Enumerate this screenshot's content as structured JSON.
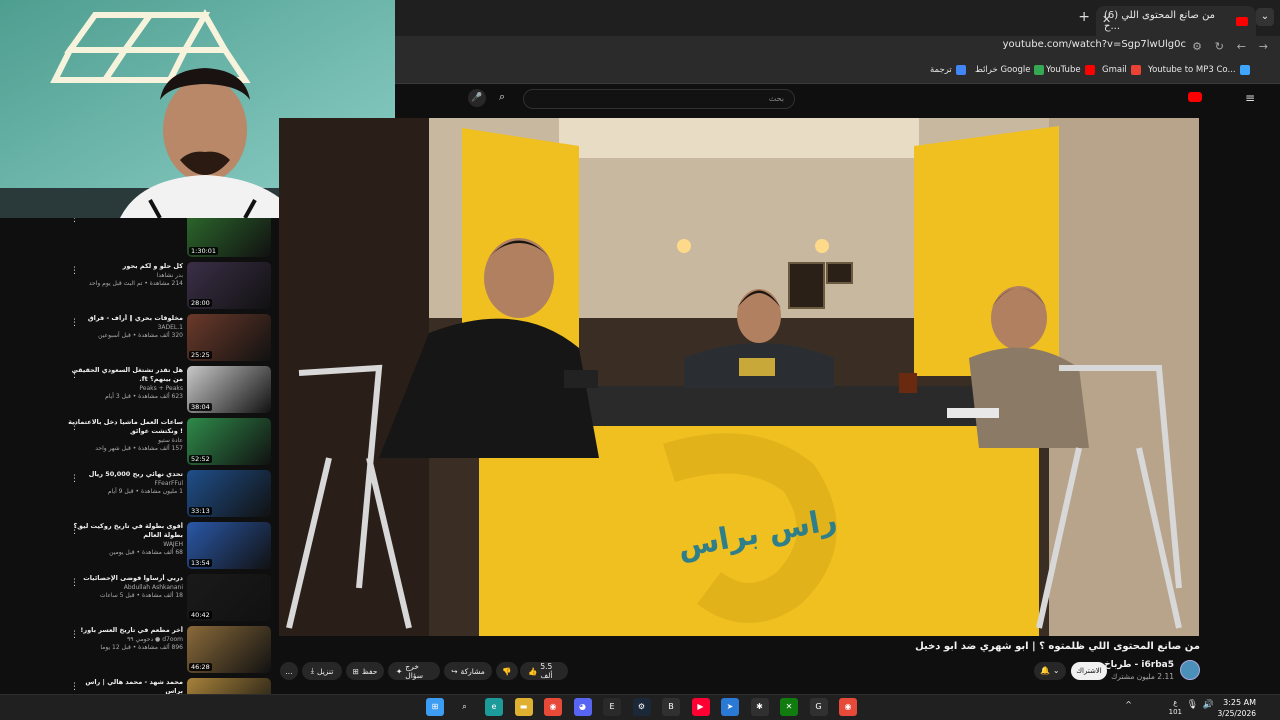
{
  "browser": {
    "tab_title": "(6) من صانع المحتوى اللي ح...",
    "url": "youtube.com/watch?v=Sgp7lwUlg0c",
    "bookmarks": [
      {
        "label": "Youtube to MP3 Co...",
        "color": "#3ea6ff"
      },
      {
        "label": "Gmail",
        "color": "#ea4335"
      },
      {
        "label": "YouTube",
        "color": "#ff0000"
      },
      {
        "label": "خرائط Google",
        "color": "#34a853"
      },
      {
        "label": "ترجمة",
        "color": "#4285f4"
      }
    ]
  },
  "youtube": {
    "search_placeholder": "بحث",
    "video_title": "من صانع المحتوى اللي ظلمتوه ؟ | ابو شهري ضد ابو دخيل",
    "channel_name": "i6rba5 - طرباخ",
    "subscribers": "2.11 مليون مشترك",
    "subscribe_label": "الاشتراك",
    "actions": {
      "likes": "5.5 ألف",
      "share": "مشاركة",
      "remix": "خرج سؤال",
      "save": "حفظ",
      "download": "تنزيل",
      "more": "..."
    }
  },
  "recommendations": [
    {
      "title": "",
      "channel": "",
      "meta": "239 ألف مشاهدة • قبل 10 أيام",
      "duration": "1:30:01",
      "color": "#2d6a2d"
    },
    {
      "title": "كل حلو و لكم بحور",
      "channel": "بدر نشاهدا",
      "meta": "214 مشاهدة • تم البث قبل يوم واحد",
      "duration": "28:00",
      "color": "#3b2f48"
    },
    {
      "title": "مخلوقات بحري ‖ أراف - فراق",
      "channel": "3ADEL.1",
      "meta": "320 ألف مشاهدة • قبل أسبوعين",
      "duration": "25:25",
      "color": "#6b3a2a"
    },
    {
      "title": "هل تقدر تشتغل السعودي الحقيقي من بينهم؟ ft.",
      "channel": "Peaks + Peaks",
      "meta": "623 ألف مشاهدة • قبل 3 أيام",
      "duration": "38:04",
      "color": "#c9c9c9"
    },
    {
      "title": "ساعات العمل ماشيا دخل بالاعتمادية ! ونكتشت عوائق",
      "channel": "عادة ستيو",
      "meta": "157 ألف مشاهدة • قبل شهر واحد",
      "duration": "52:52",
      "color": "#2f8a4a"
    },
    {
      "title": "تحدي نهائي ربح 50,000 ريال",
      "channel": "FFearFFul",
      "meta": "1 مليون مشاهدة • قبل 9 أيام",
      "duration": "33:13",
      "color": "#1f4f8a"
    },
    {
      "title": "أقوى بطولة في تاريخ روكيت ليق؟ بطولة العالم",
      "channel": "WAJEH",
      "meta": "68 ألف مشاهدة • قبل يومين",
      "duration": "13:54",
      "color": "#2a58a8"
    },
    {
      "title": "دربي أرساوا فوضى الإحصائيات",
      "channel": "Abdullah Ashkanani",
      "meta": "18 ألف مشاهدة • قبل 5 ساعات",
      "duration": "40:42",
      "color": "#1a1a1a"
    },
    {
      "title": "أخر مطعم في تاريخ العسر باور!",
      "channel": "d7oom ● دحومي ٩٩",
      "meta": "896 ألف مشاهدة • قبل 12 يوما",
      "duration": "46:28",
      "color": "#8a6a3a"
    },
    {
      "title": "محمد شهد - محمد هالي | راس براس",
      "channel": "i6rba5",
      "meta": "",
      "duration": "",
      "color": "#a8823a"
    }
  ],
  "taskbar": {
    "time": "3:25 AM",
    "date": "3/25/2026",
    "lang_line1": "ع",
    "lang_line2": "101",
    "apps": [
      {
        "icon": "windows-start",
        "color": "#3d9df2"
      },
      {
        "icon": "search",
        "color": "#202020"
      },
      {
        "icon": "edge",
        "color": "#1d9a9a"
      },
      {
        "icon": "file-explorer",
        "color": "#e0b030"
      },
      {
        "icon": "chrome",
        "color": "#e84a3a"
      },
      {
        "icon": "discord",
        "color": "#5865f2"
      },
      {
        "icon": "epic-games",
        "color": "#2a2a2a"
      },
      {
        "icon": "steam",
        "color": "#1b2838"
      },
      {
        "icon": "app-bm",
        "color": "#303030"
      },
      {
        "icon": "youtube-music",
        "color": "#ff0033"
      },
      {
        "icon": "paper-plane",
        "color": "#2a7ad5"
      },
      {
        "icon": "settings",
        "color": "#303030"
      },
      {
        "icon": "xbox",
        "color": "#107c10"
      },
      {
        "icon": "app-g",
        "color": "#303030"
      },
      {
        "icon": "chrome-active",
        "color": "#e84a3a"
      }
    ]
  },
  "colors": {
    "background": "#0f0f0f",
    "accent_red": "#ff0000",
    "table_yellow": "#f0c020"
  }
}
